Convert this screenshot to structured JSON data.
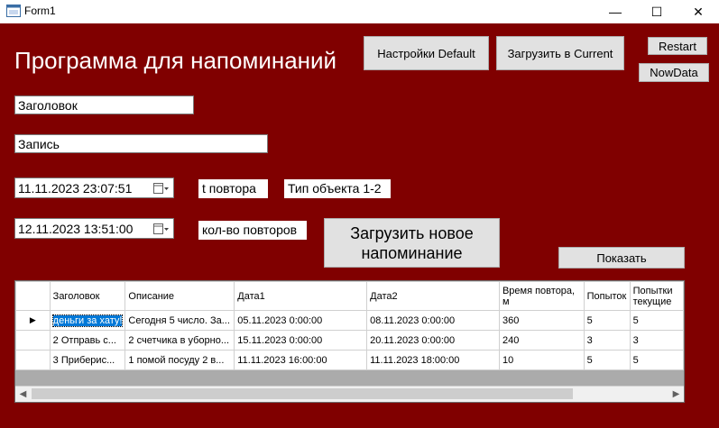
{
  "window": {
    "title": "Form1",
    "minimize": "—",
    "maximize": "☐",
    "close": "✕"
  },
  "heading": "Программа для напоминаний",
  "buttons": {
    "settings_default": "Настройки Default",
    "load_current": "Загрузить в Current",
    "restart": "Restart",
    "now_data": "NowData",
    "load_new": "Загрузить новое напоминание",
    "show": "Показать"
  },
  "fields": {
    "title": "Заголовок",
    "record": "Запись",
    "date1": "11.11.2023 23:07:51",
    "date2": "12.11.2023 13:51:00"
  },
  "labels": {
    "t_repeat": "t повтора",
    "object_type": "Тип объекта 1-2",
    "repeat_count": "кол-во повторов"
  },
  "grid": {
    "columns": [
      "Заголовок",
      "Описание",
      "Дата1",
      "Дата2",
      "Время повтора, м",
      "Попыток",
      "Попытки текущие"
    ],
    "rows": [
      [
        "деньги за хату!",
        "Сегодня 5 число. За...",
        "05.11.2023 0:00:00",
        "08.11.2023 0:00:00",
        "360",
        "5",
        "5"
      ],
      [
        "2 Отправь с...",
        "2 счетчика в уборно...",
        "15.11.2023 0:00:00",
        "20.11.2023 0:00:00",
        "240",
        "3",
        "3"
      ],
      [
        "3 Приберис...",
        "1 помой посуду 2 в...",
        "11.11.2023 16:00:00",
        "11.11.2023 18:00:00",
        "10",
        "5",
        "5"
      ]
    ],
    "current_row_marker": "▶"
  },
  "icons": {
    "app": "form-app-icon",
    "calendar": "calendar-dropdown-icon"
  }
}
